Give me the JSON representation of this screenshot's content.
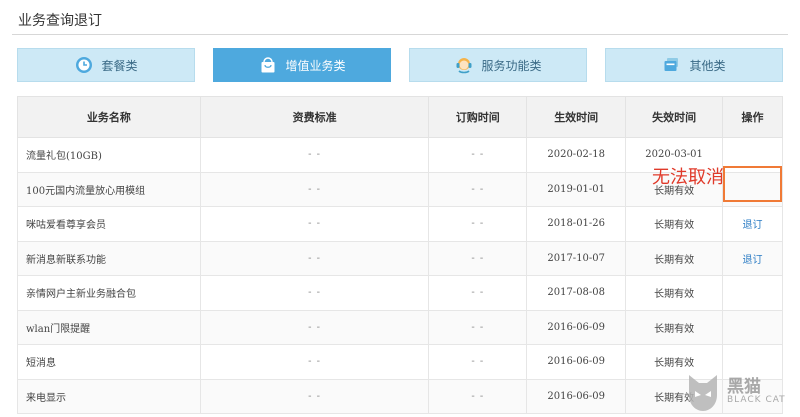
{
  "page": {
    "title": "业务查询退订"
  },
  "tabs": [
    {
      "label": "套餐类",
      "icon": "clock-icon",
      "active": false
    },
    {
      "label": "增值业务类",
      "icon": "shopping-bag-icon",
      "active": true
    },
    {
      "label": "服务功能类",
      "icon": "customer-service-icon",
      "active": false
    },
    {
      "label": "其他类",
      "icon": "cards-icon",
      "active": false
    }
  ],
  "table": {
    "headers": [
      "业务名称",
      "资费标准",
      "订购时间",
      "生效时间",
      "失效时间",
      "操作"
    ],
    "rows": [
      {
        "name": "流量礼包(10GB)",
        "fee": "- -",
        "order_time": "- -",
        "effective": "2020-02-18",
        "expiry": "2020-03-01",
        "action": ""
      },
      {
        "name": "100元国内流量放心用模组",
        "fee": "- -",
        "order_time": "- -",
        "effective": "2019-01-01",
        "expiry": "长期有效",
        "action": ""
      },
      {
        "name": "咪咕爱看尊享会员",
        "fee": "- -",
        "order_time": "- -",
        "effective": "2018-01-26",
        "expiry": "长期有效",
        "action": "退订"
      },
      {
        "name": "新消息新联系功能",
        "fee": "- -",
        "order_time": "- -",
        "effective": "2017-10-07",
        "expiry": "长期有效",
        "action": "退订"
      },
      {
        "name": "亲情网户主新业务融合包",
        "fee": "- -",
        "order_time": "- -",
        "effective": "2017-08-08",
        "expiry": "长期有效",
        "action": ""
      },
      {
        "name": "wlan门限提醒",
        "fee": "- -",
        "order_time": "- -",
        "effective": "2016-06-09",
        "expiry": "长期有效",
        "action": ""
      },
      {
        "name": "短消息",
        "fee": "- -",
        "order_time": "- -",
        "effective": "2016-06-09",
        "expiry": "长期有效",
        "action": ""
      },
      {
        "name": "来电显示",
        "fee": "- -",
        "order_time": "- -",
        "effective": "2016-06-09",
        "expiry": "长期有效",
        "action": ""
      }
    ]
  },
  "annotation": {
    "text": "无法取消",
    "color": "#e03a2a",
    "box_color": "#f07a36"
  },
  "watermark": {
    "cn": "黑猫",
    "en": "BLACK CAT"
  },
  "colors": {
    "active_tab": "#4ea9de",
    "inactive_tab": "#cde9f6",
    "link": "#2a7bc4"
  }
}
